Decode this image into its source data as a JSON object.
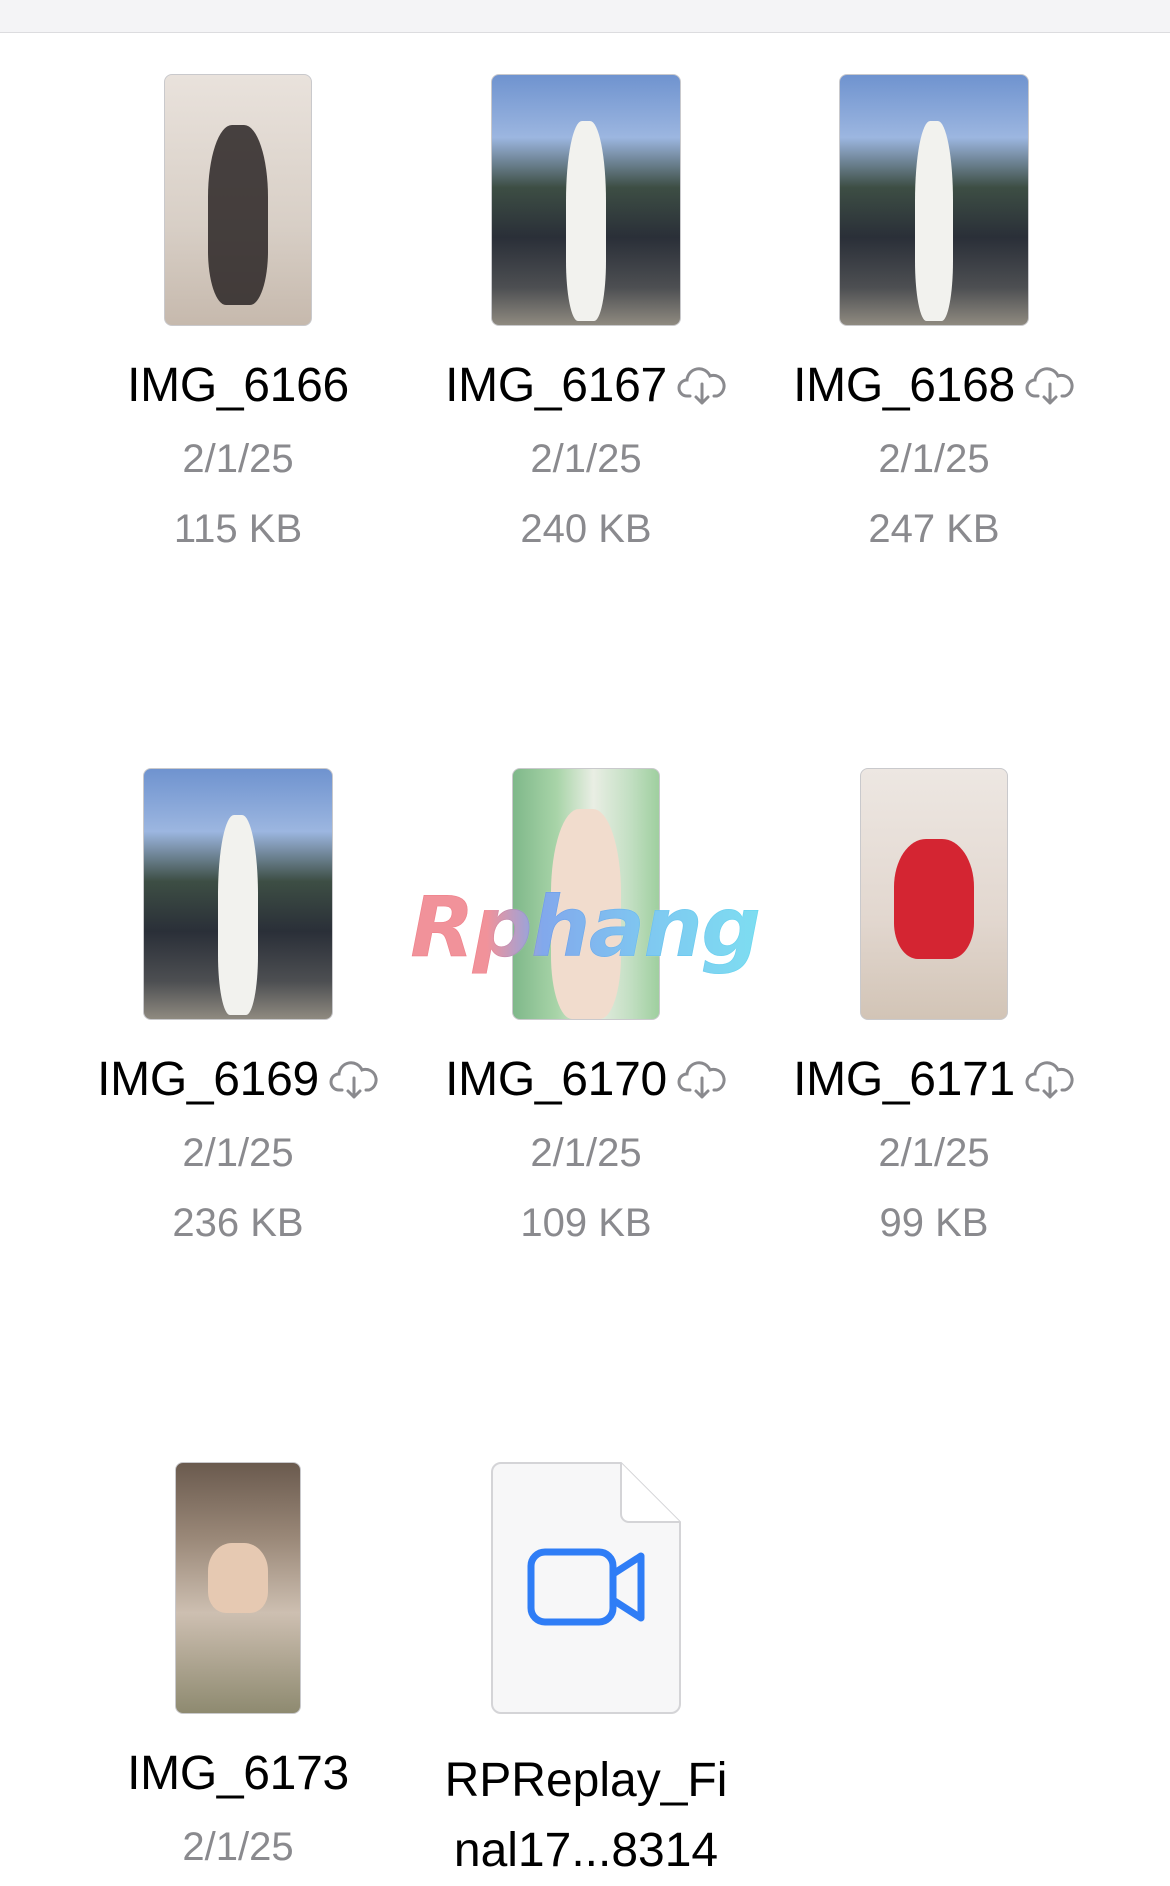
{
  "files": [
    {
      "name": "IMG_6166",
      "date": "2/1/25",
      "size": "115 KB",
      "cloud": false,
      "icon": "photo-thumbnail"
    },
    {
      "name": "IMG_6167",
      "date": "2/1/25",
      "size": "240 KB",
      "cloud": true,
      "icon": "photo-thumbnail"
    },
    {
      "name": "IMG_6168",
      "date": "2/1/25",
      "size": "247 KB",
      "cloud": true,
      "icon": "photo-thumbnail"
    },
    {
      "name": "IMG_6169",
      "date": "2/1/25",
      "size": "236 KB",
      "cloud": true,
      "icon": "photo-thumbnail"
    },
    {
      "name": "IMG_6170",
      "date": "2/1/25",
      "size": "109 KB",
      "cloud": true,
      "icon": "photo-thumbnail"
    },
    {
      "name": "IMG_6171",
      "date": "2/1/25",
      "size": "99 KB",
      "cloud": true,
      "icon": "photo-thumbnail"
    },
    {
      "name": "IMG_6173",
      "date": "2/1/25",
      "icon": "photo-thumbnail"
    },
    {
      "name_line1": "RPReplay_Fi",
      "name_line2": "nal17...8314",
      "icon": "video-camera-icon"
    }
  ],
  "watermark": "Rphang",
  "colors": {
    "title": "#000000",
    "meta": "#8a8a8e",
    "video_icon": "#2f7df6",
    "cloud_icon": "#8a8a8e"
  }
}
